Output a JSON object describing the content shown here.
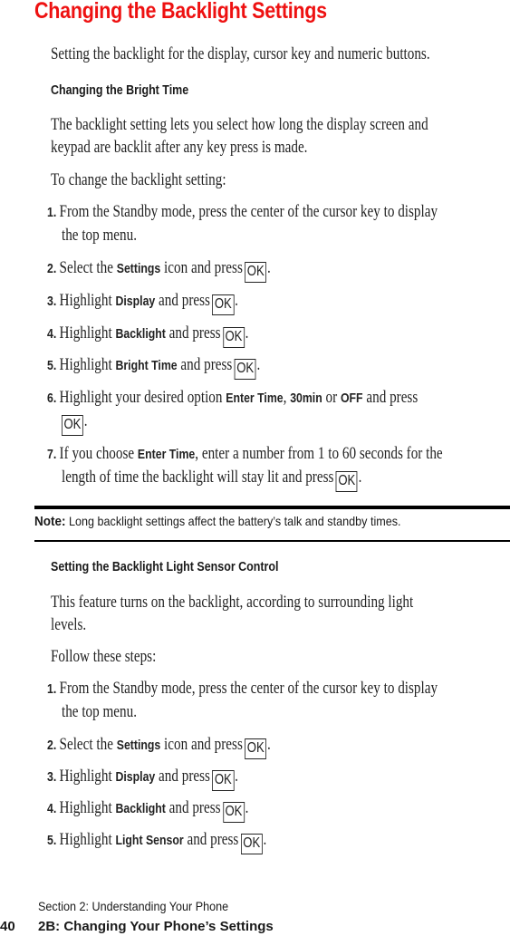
{
  "title": "Changing the Backlight Settings",
  "intro": "Setting the backlight for the display, cursor key and numeric buttons.",
  "section1": {
    "heading": "Changing the Bright Time",
    "para_line1": "The backlight setting lets you select how long the display screen and",
    "para_line2": "keypad are backlit after any key press is made.",
    "lead": "To change the backlight setting:",
    "steps": [
      {
        "num": "1.",
        "line1": "From the Standby mode, press the center of the cursor key to display",
        "line2": "the top menu."
      },
      {
        "num": "2.",
        "pre": "Select the ",
        "bold": "Settings",
        "post": " icon and press",
        "key": "OK",
        "end": "."
      },
      {
        "num": "3.",
        "pre": "Highlight ",
        "bold": "Display",
        "post": " and press",
        "key": "OK",
        "end": "."
      },
      {
        "num": "4.",
        "pre": "Highlight ",
        "bold": "Backlight",
        "post": " and press",
        "key": "OK",
        "end": "."
      },
      {
        "num": "5.",
        "pre": "Highlight ",
        "bold": "Bright Time",
        "post": " and press",
        "key": "OK",
        "end": "."
      },
      {
        "num": "6.",
        "pre": "Highlight your desired option ",
        "bold1": "Enter Time",
        "sep1": ", ",
        "bold2": "30min",
        "sep2": " or ",
        "bold3": "OFF",
        "post": " and press",
        "key": "OK",
        "end": "."
      },
      {
        "num": "7.",
        "pre": "If you choose ",
        "bold": "Enter Time",
        "post": ", enter a number from 1 to 60 seconds for the",
        "line2": "length of time the backlight will stay lit and press",
        "key": "OK",
        "end": "."
      }
    ]
  },
  "note": {
    "label": "Note:",
    "text": " Long backlight settings affect the battery’s talk and standby times."
  },
  "section2": {
    "heading": "Setting the Backlight Light Sensor Control",
    "para_line1": "This feature turns on the backlight, according to surrounding light",
    "para_line2": "levels.",
    "lead": "Follow these steps:",
    "steps": [
      {
        "num": "1.",
        "line1": "From the Standby mode, press the center of the cursor key to display",
        "line2": "the top menu."
      },
      {
        "num": "2.",
        "pre": "Select the ",
        "bold": "Settings",
        "post": " icon and press",
        "key": "OK",
        "end": "."
      },
      {
        "num": "3.",
        "pre": "Highlight ",
        "bold": "Display",
        "post": " and press",
        "key": "OK",
        "end": "."
      },
      {
        "num": "4.",
        "pre": "Highlight ",
        "bold": "Backlight",
        "post": " and press",
        "key": "OK",
        "end": "."
      },
      {
        "num": "5.",
        "pre": "Highlight ",
        "bold": "Light Sensor",
        "post": " and press",
        "key": "OK",
        "end": "."
      }
    ]
  },
  "footer": {
    "section": "Section 2: Understanding Your Phone",
    "page_number": "40",
    "chapter": "2B: Changing Your Phone’s Settings"
  }
}
